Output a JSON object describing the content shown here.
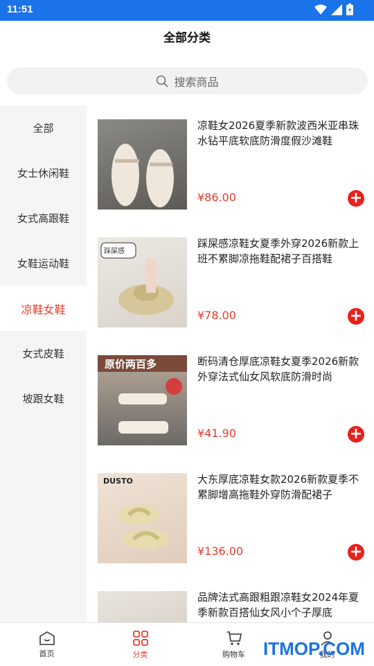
{
  "status": {
    "time": "11:51"
  },
  "header": {
    "title": "全部分类"
  },
  "search": {
    "placeholder": "搜索商品"
  },
  "sidebar": {
    "items": [
      {
        "label": "全部",
        "active": false
      },
      {
        "label": "女士休闲鞋",
        "active": false
      },
      {
        "label": "女式高跟鞋",
        "active": false
      },
      {
        "label": "女鞋运动鞋",
        "active": false
      },
      {
        "label": "凉鞋女鞋",
        "active": true
      },
      {
        "label": "女式皮鞋",
        "active": false
      },
      {
        "label": "坡跟女鞋",
        "active": false
      }
    ]
  },
  "products": [
    {
      "name": "凉鞋女2026夏季新款波西米亚串珠水钻平底软底防滑度假沙滩鞋",
      "price": "¥86.00"
    },
    {
      "name": "踩屎感凉鞋女夏季外穿2026新款上班不累脚凉拖鞋配裙子百搭鞋",
      "price": "¥78.00",
      "badge": "踩屎感"
    },
    {
      "name": "断码清仓厚底凉鞋女夏季2026新款外穿法式仙女风软底防滑时尚",
      "price": "¥41.90",
      "badge": "原价两百多"
    },
    {
      "name": "大东厚底凉鞋女款2026新款夏季不累脚增高拖鞋外穿防滑配裙子",
      "price": "¥136.00",
      "badge": "DUSTO"
    },
    {
      "name": "品牌法式高跟粗跟凉鞋女2024年夏季新款百搭仙女风小个子厚底",
      "price": ""
    }
  ],
  "tabbar": {
    "items": [
      {
        "label": "首页",
        "icon": "home-icon"
      },
      {
        "label": "分类",
        "icon": "category-icon",
        "active": true
      },
      {
        "label": "购物车",
        "icon": "cart-icon"
      },
      {
        "label": "我的",
        "icon": "user-icon"
      }
    ]
  },
  "watermark": "ITMOP.COM",
  "colors": {
    "accent": "#e63c2e",
    "statusbar": "#1a73e8"
  }
}
